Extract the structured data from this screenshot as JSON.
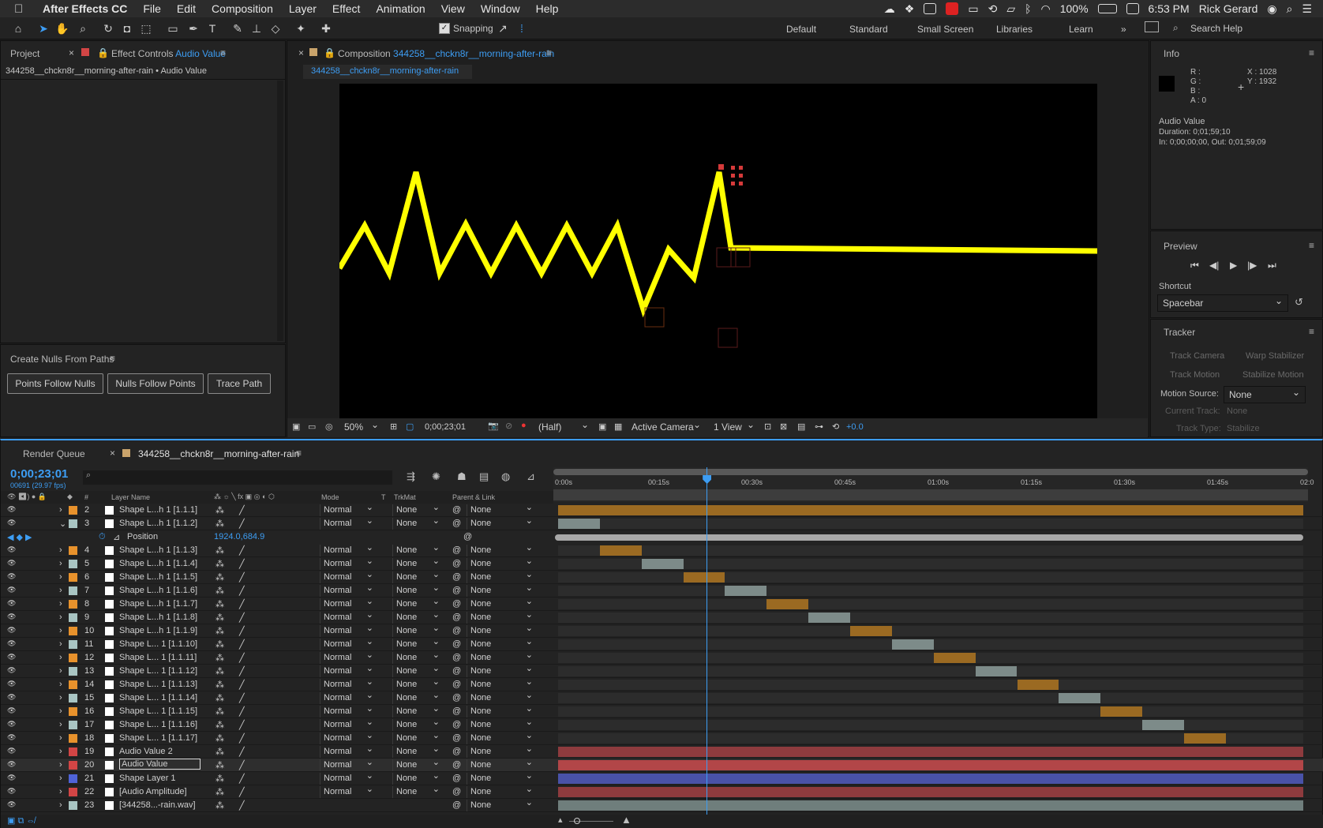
{
  "menubar": {
    "app": "After Effects CC",
    "items": [
      "File",
      "Edit",
      "Composition",
      "Layer",
      "Effect",
      "Animation",
      "View",
      "Window",
      "Help"
    ],
    "battery": "100%",
    "time": "6:53 PM",
    "user": "Rick Gerard"
  },
  "toolbar": {
    "snapping": "Snapping",
    "workspaces": [
      "Default",
      "Standard",
      "Small Screen",
      "Libraries",
      "Learn"
    ],
    "search_help": "Search Help"
  },
  "project_panel": {
    "tab_project": "Project",
    "tab_effect_controls": "Effect Controls",
    "effect_controls_layer": "Audio Value",
    "breadcrumb": "344258__chckn8r__morning-after-rain • Audio Value"
  },
  "nulls_panel": {
    "title": "Create Nulls From Paths",
    "buttons": [
      "Points Follow Nulls",
      "Nulls Follow Points",
      "Trace Path"
    ]
  },
  "comp_panel": {
    "tab_label": "Composition",
    "comp_name": "344258__chckn8r__morning-after-rain",
    "sub_tab": "344258__chckn8r__morning-after-rain",
    "zoom": "50%",
    "timecode": "0;00;23;01",
    "resolution": "(Half)",
    "camera": "Active Camera",
    "view": "1 View",
    "exposure": "+0.0"
  },
  "info_panel": {
    "title": "Info",
    "r": "R :",
    "g": "G :",
    "b": "B :",
    "a": "A :  0",
    "x": "X : 1028",
    "y": "Y : 1932",
    "layer": "Audio Value",
    "duration": "Duration: 0;01;59;10",
    "inout": "In: 0;00;00;00, Out: 0;01;59;09"
  },
  "preview_panel": {
    "title": "Preview",
    "shortcut_label": "Shortcut",
    "shortcut_value": "Spacebar"
  },
  "tracker_panel": {
    "title": "Tracker",
    "track_camera": "Track Camera",
    "warp_stabilizer": "Warp Stabilizer",
    "track_motion": "Track Motion",
    "stabilize_motion": "Stabilize Motion",
    "motion_source_label": "Motion Source:",
    "motion_source_value": "None",
    "current_track_label": "Current Track:",
    "current_track_value": "None",
    "track_type_label": "Track Type:",
    "track_type_value": "Stabilize"
  },
  "timeline": {
    "tab_render_queue": "Render Queue",
    "tab_comp": "344258__chckn8r__morning-after-rain",
    "current_time": "0;00;23;01",
    "frame_info": "00691 (29.97 fps)",
    "col_num": "#",
    "col_layer_name": "Layer Name",
    "col_mode": "Mode",
    "col_t": "T",
    "col_trkmat": "TrkMat",
    "col_parent": "Parent & Link",
    "ruler": [
      "0:00s",
      "00:15s",
      "00:30s",
      "00:45s",
      "01:00s",
      "01:15s",
      "01:30s",
      "01:45s",
      "02:0"
    ],
    "playhead_fraction": 0.193,
    "position_label": "Position",
    "position_value": "1924.0,684.9",
    "layers": [
      {
        "num": "2",
        "name": "Shape L...h 1 [1.1.1]",
        "color": "#e8922c",
        "mode": "Normal",
        "trkmat": "None",
        "parent": "None",
        "bar_start": 0.0,
        "bar_end": 1.0,
        "bar_color": "#9b6a22"
      },
      {
        "num": "3",
        "name": "Shape L...h 1 [1.1.2]",
        "color": "#a9c5c3",
        "mode": "Normal",
        "trkmat": "None",
        "parent": "None",
        "bar_start": 0.0,
        "bar_end": 0.056,
        "bar_color": "#7d8b89"
      },
      {
        "num": "4",
        "name": "Shape L...h 1 [1.1.3]",
        "color": "#e8922c",
        "mode": "Normal",
        "trkmat": "None",
        "parent": "None",
        "bar_start": 0.056,
        "bar_end": 0.112,
        "bar_color": "#9b6a22"
      },
      {
        "num": "5",
        "name": "Shape L...h 1 [1.1.4]",
        "color": "#a9c5c3",
        "mode": "Normal",
        "trkmat": "None",
        "parent": "None",
        "bar_start": 0.112,
        "bar_end": 0.168,
        "bar_color": "#7d8b89"
      },
      {
        "num": "6",
        "name": "Shape L...h 1 [1.1.5]",
        "color": "#e8922c",
        "mode": "Normal",
        "trkmat": "None",
        "parent": "None",
        "bar_start": 0.168,
        "bar_end": 0.224,
        "bar_color": "#9b6a22"
      },
      {
        "num": "7",
        "name": "Shape L...h 1 [1.1.6]",
        "color": "#a9c5c3",
        "mode": "Normal",
        "trkmat": "None",
        "parent": "None",
        "bar_start": 0.224,
        "bar_end": 0.28,
        "bar_color": "#7d8b89"
      },
      {
        "num": "8",
        "name": "Shape L...h 1 [1.1.7]",
        "color": "#e8922c",
        "mode": "Normal",
        "trkmat": "None",
        "parent": "None",
        "bar_start": 0.28,
        "bar_end": 0.336,
        "bar_color": "#9b6a22"
      },
      {
        "num": "9",
        "name": "Shape L...h 1 [1.1.8]",
        "color": "#a9c5c3",
        "mode": "Normal",
        "trkmat": "None",
        "parent": "None",
        "bar_start": 0.336,
        "bar_end": 0.392,
        "bar_color": "#7d8b89"
      },
      {
        "num": "10",
        "name": "Shape L...h 1 [1.1.9]",
        "color": "#e8922c",
        "mode": "Normal",
        "trkmat": "None",
        "parent": "None",
        "bar_start": 0.392,
        "bar_end": 0.448,
        "bar_color": "#9b6a22"
      },
      {
        "num": "11",
        "name": "Shape L... 1 [1.1.10]",
        "color": "#a9c5c3",
        "mode": "Normal",
        "trkmat": "None",
        "parent": "None",
        "bar_start": 0.448,
        "bar_end": 0.504,
        "bar_color": "#7d8b89"
      },
      {
        "num": "12",
        "name": "Shape L... 1 [1.1.11]",
        "color": "#e8922c",
        "mode": "Normal",
        "trkmat": "None",
        "parent": "None",
        "bar_start": 0.504,
        "bar_end": 0.56,
        "bar_color": "#9b6a22"
      },
      {
        "num": "13",
        "name": "Shape L... 1 [1.1.12]",
        "color": "#a9c5c3",
        "mode": "Normal",
        "trkmat": "None",
        "parent": "None",
        "bar_start": 0.56,
        "bar_end": 0.616,
        "bar_color": "#7d8b89"
      },
      {
        "num": "14",
        "name": "Shape L... 1 [1.1.13]",
        "color": "#e8922c",
        "mode": "Normal",
        "trkmat": "None",
        "parent": "None",
        "bar_start": 0.616,
        "bar_end": 0.672,
        "bar_color": "#9b6a22"
      },
      {
        "num": "15",
        "name": "Shape L... 1 [1.1.14]",
        "color": "#a9c5c3",
        "mode": "Normal",
        "trkmat": "None",
        "parent": "None",
        "bar_start": 0.672,
        "bar_end": 0.728,
        "bar_color": "#7d8b89"
      },
      {
        "num": "16",
        "name": "Shape L... 1 [1.1.15]",
        "color": "#e8922c",
        "mode": "Normal",
        "trkmat": "None",
        "parent": "None",
        "bar_start": 0.728,
        "bar_end": 0.784,
        "bar_color": "#9b6a22"
      },
      {
        "num": "17",
        "name": "Shape L... 1 [1.1.16]",
        "color": "#a9c5c3",
        "mode": "Normal",
        "trkmat": "None",
        "parent": "None",
        "bar_start": 0.784,
        "bar_end": 0.84,
        "bar_color": "#7d8b89"
      },
      {
        "num": "18",
        "name": "Shape L... 1 [1.1.17]",
        "color": "#e8922c",
        "mode": "Normal",
        "trkmat": "None",
        "parent": "None",
        "bar_start": 0.84,
        "bar_end": 0.896,
        "bar_color": "#9b6a22"
      },
      {
        "num": "19",
        "name": "Audio Value 2",
        "color": "#d24545",
        "mode": "Normal",
        "trkmat": "None",
        "parent": "None",
        "bar_start": 0.0,
        "bar_end": 1.0,
        "bar_color": "#8e3b3e"
      },
      {
        "num": "20",
        "name": "Audio Value",
        "color": "#d24545",
        "mode": "Normal",
        "trkmat": "None",
        "parent": "None",
        "bar_start": 0.0,
        "bar_end": 1.0,
        "bar_color": "#b24648"
      },
      {
        "num": "21",
        "name": "Shape Layer 1",
        "color": "#4f63d8",
        "mode": "Normal",
        "trkmat": "None",
        "parent": "None",
        "bar_start": 0.0,
        "bar_end": 1.0,
        "bar_color": "#4952a8"
      },
      {
        "num": "22",
        "name": "[Audio Amplitude]",
        "color": "#d24545",
        "mode": "Normal",
        "trkmat": "None",
        "parent": "None",
        "bar_start": 0.0,
        "bar_end": 1.0,
        "bar_color": "#8e3b3e"
      },
      {
        "num": "23",
        "name": "[344258...-rain.wav]",
        "color": "#a9c5c3",
        "mode": "",
        "trkmat": "",
        "parent": "None",
        "bar_start": 0.0,
        "bar_end": 1.0,
        "bar_color": "#6f7e7c"
      }
    ]
  },
  "colors": {
    "accent": "#3d9df3",
    "waveform": "#ffff00",
    "orange": "#e8922c",
    "aqua": "#a9c5c3"
  }
}
